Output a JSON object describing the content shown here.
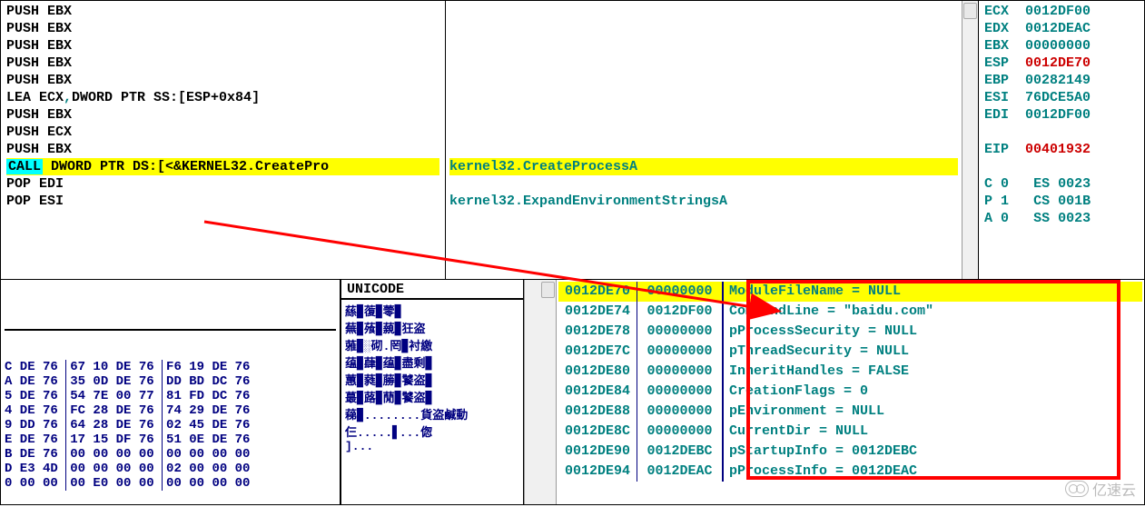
{
  "disasm": {
    "lines": [
      {
        "text": "PUSH EBX",
        "hl": false
      },
      {
        "text": "PUSH EBX",
        "hl": false
      },
      {
        "text": "PUSH EBX",
        "hl": false
      },
      {
        "text": "PUSH EBX",
        "hl": false
      },
      {
        "text": "PUSH EBX",
        "hl": false
      },
      {
        "text": "LEA ECX,DWORD PTR SS:[ESP+0x84]",
        "hl": false,
        "comma": true
      },
      {
        "text": "PUSH EBX",
        "hl": false
      },
      {
        "text": "PUSH ECX",
        "hl": false
      },
      {
        "text": "PUSH EBX",
        "hl": false
      },
      {
        "call": true,
        "rest": " DWORD PTR DS:[<&KERNEL32.CreatePro",
        "hl": true
      },
      {
        "text": "POP EDI",
        "hl": false
      },
      {
        "text": "POP ESI",
        "hl": false
      }
    ],
    "info_lines": [
      {
        "row": 9,
        "text": "kernel32.CreateProcessA",
        "hl": true
      },
      {
        "row": 11,
        "text": "kernel32.ExpandEnvironmentStringsA",
        "hl": false
      }
    ],
    "call_keyword": "CALL"
  },
  "registers": {
    "rows": [
      {
        "name": "ECX",
        "val": "0012DF00",
        "red": false
      },
      {
        "name": "EDX",
        "val": "0012DEAC",
        "red": false
      },
      {
        "name": "EBX",
        "val": "00000000",
        "red": false
      },
      {
        "name": "ESP",
        "val": "0012DE70",
        "red": true
      },
      {
        "name": "EBP",
        "val": "00282149",
        "red": false
      },
      {
        "name": "ESI",
        "val": "76DCE5A0",
        "red": false
      },
      {
        "name": "EDI",
        "val": "0012DF00",
        "red": false
      },
      {
        "name": "",
        "val": "",
        "red": false
      },
      {
        "name": "EIP",
        "val": "00401932",
        "red": true
      }
    ],
    "flags": [
      {
        "name": "C",
        "val": "0",
        "seg": "ES",
        "segval": "0023"
      },
      {
        "name": "P",
        "val": "1",
        "seg": "CS",
        "segval": "001B"
      },
      {
        "name": "A",
        "val": "0",
        "seg": "SS",
        "segval": "0023"
      }
    ],
    "flags_cut": "023"
  },
  "dump": {
    "unicode_header": "UNICODE",
    "hex_rows": [
      "C DE 76 67 10 DE 76 F6 19 DE 76",
      "A DE 76 35 0D DE 76 DD BD DC 76",
      "5 DE 76 54 7E 00 77 81 FD DC 76",
      "4 DE 76 FC 28 DE 76 74 29 DE 76",
      "9 DD 76 64 28 DE 76 02 45 DE 76",
      "E DE 76 17 15 DF 76 51 0E DE 76",
      "B DE 76 00 00 00 00 00 00 00 00",
      "D E3 4D 00 00 00 00 02 00 00 00",
      "0 00 00 00 E0 00 00 00 00 00 00"
    ],
    "unicode_rows": [
      "蕬▉蕧▉蕶▉",
      "蕪▉蕵▉藽▉狂盗",
      "蕥▉░砌.罔▉衬繳",
      "蕴▉蕼▉蕴▉盡剩▉",
      "蕙▉蕤▉蕂▉饕盗▉",
      "蕞▉蕗▉蕑▉饕盗▉",
      "蕛▉........貨盗鹹動",
      "仨.....▋...偬",
      "]..."
    ]
  },
  "stack": {
    "rows": [
      {
        "addr": "0012DE70",
        "val": "00000000",
        "sym": "ModuleFileName = NULL",
        "hl": true,
        "cut": true
      },
      {
        "addr": "0012DE74",
        "val": "0012DF00",
        "sym": "CommandLine = \"baidu.com\"",
        "hl": false,
        "cut": true
      },
      {
        "addr": "0012DE78",
        "val": "00000000",
        "sym": "pProcessSecurity = NULL",
        "hl": false
      },
      {
        "addr": "0012DE7C",
        "val": "00000000",
        "sym": "pThreadSecurity = NULL",
        "hl": false
      },
      {
        "addr": "0012DE80",
        "val": "00000000",
        "sym": "InheritHandles = FALSE",
        "hl": false
      },
      {
        "addr": "0012DE84",
        "val": "00000000",
        "sym": "CreationFlags = 0",
        "hl": false
      },
      {
        "addr": "0012DE88",
        "val": "00000000",
        "sym": "pEnvironment = NULL",
        "hl": false
      },
      {
        "addr": "0012DE8C",
        "val": "00000000",
        "sym": "CurrentDir = NULL",
        "hl": false
      },
      {
        "addr": "0012DE90",
        "val": "0012DEBC",
        "sym": "pStartupInfo = 0012DEBC",
        "hl": false,
        "cut": true
      },
      {
        "addr": "0012DE94",
        "val": "0012DEAC",
        "sym": "pProcessInfo = 0012DEAC",
        "hl": false,
        "cut": true
      }
    ]
  },
  "watermark": "亿速云"
}
